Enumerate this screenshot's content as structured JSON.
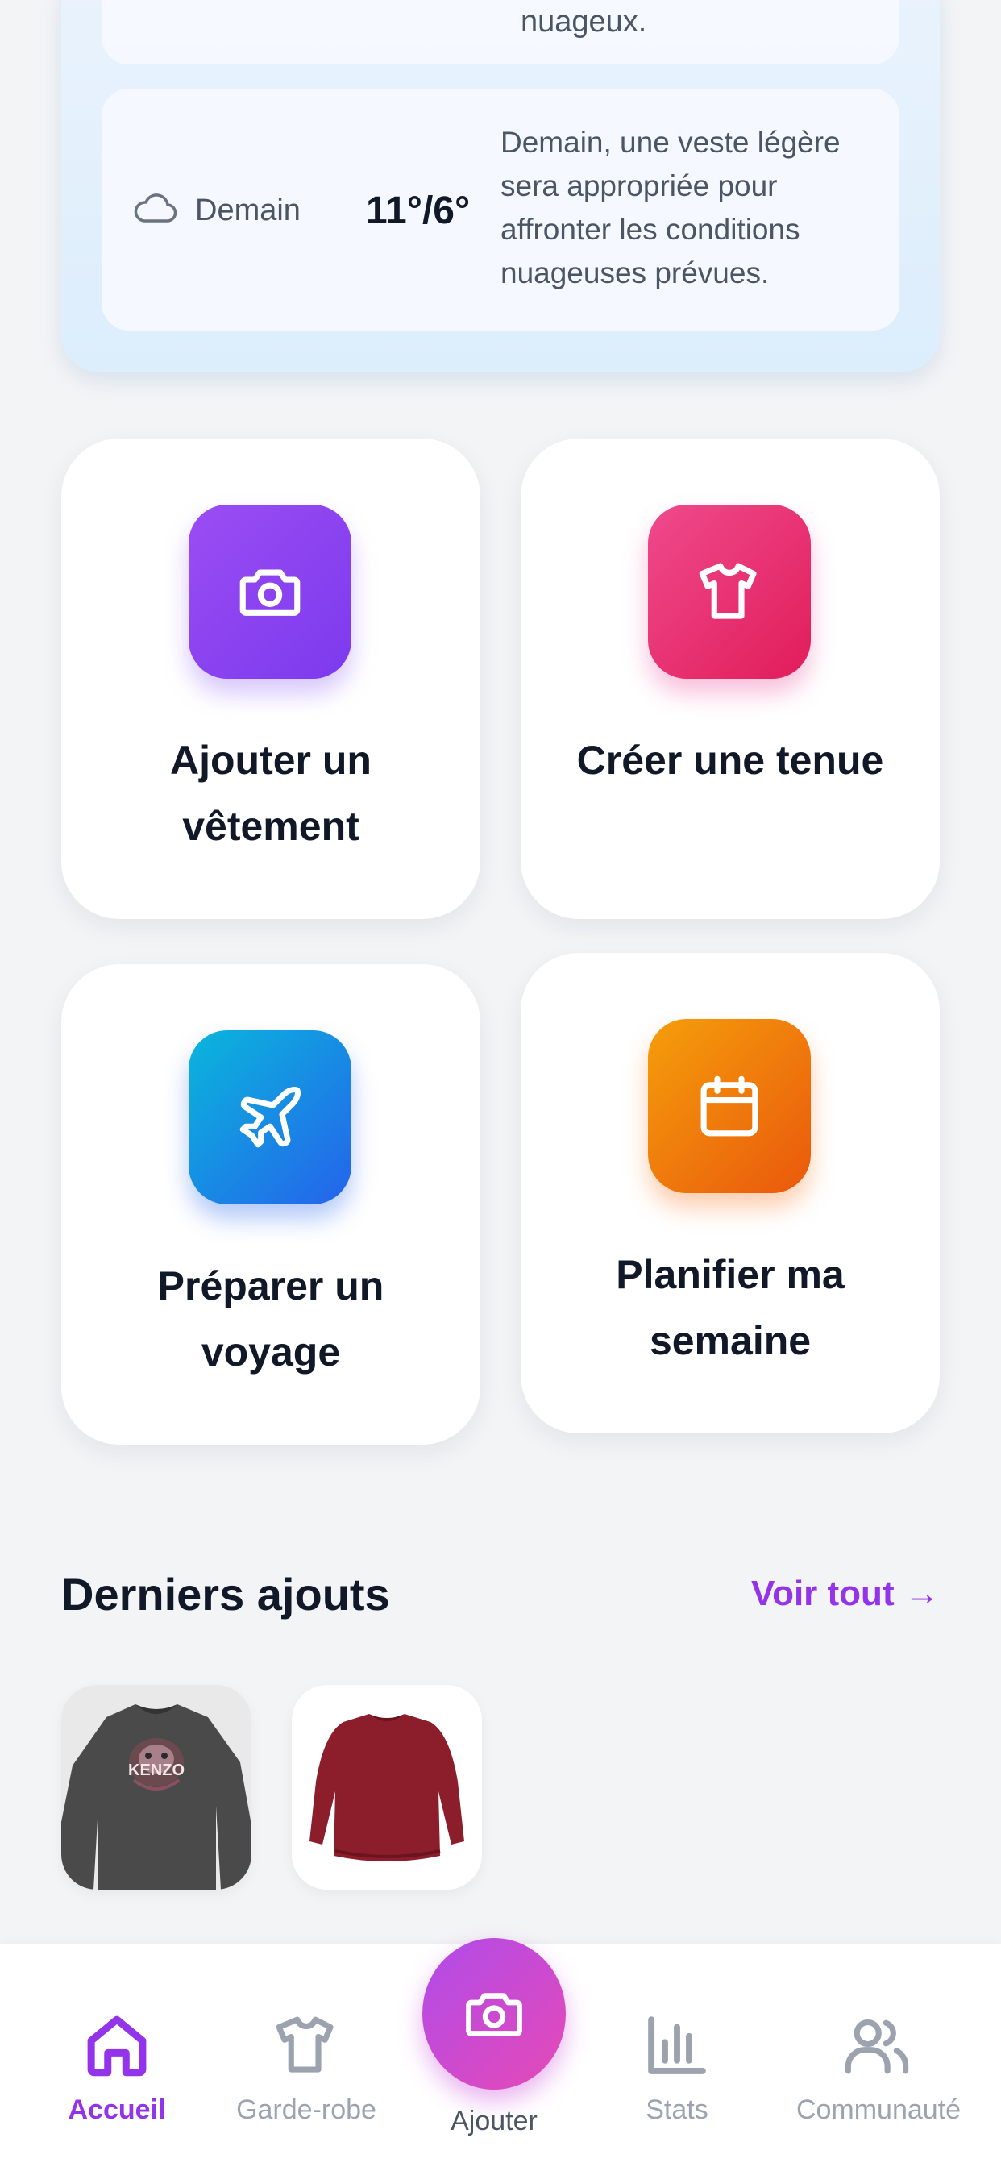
{
  "weather": {
    "top_text": "nuageux.",
    "tomorrow": {
      "icon": "cloud-icon",
      "day": "Demain",
      "temp": "11°/6°",
      "description": "Demain, une veste légère sera appropriée pour affronter les conditions nuageuses prévues."
    }
  },
  "actions": [
    {
      "label": "Ajouter un vêtement",
      "icon": "camera-icon",
      "color": "#8b5cf6"
    },
    {
      "label": "Créer une tenue",
      "icon": "tshirt-icon",
      "color": "#ec4899"
    },
    {
      "label": "Préparer un voyage",
      "icon": "plane-icon",
      "color": "#2563eb"
    },
    {
      "label": "Planifier ma semaine",
      "icon": "calendar-icon",
      "color": "#f97316"
    }
  ],
  "recent": {
    "title": "Derniers ajouts",
    "see_all": "Voir tout →",
    "items": [
      {
        "name": "grey-sweatshirt-tiger",
        "logo_text": "KENZO"
      },
      {
        "name": "burgundy-sweater"
      }
    ]
  },
  "nav": {
    "active": "Accueil",
    "items": [
      {
        "label": "Accueil",
        "icon": "home-icon"
      },
      {
        "label": "Garde-robe",
        "icon": "tshirt-icon"
      },
      {
        "label": "Ajouter",
        "icon": "camera-icon"
      },
      {
        "label": "Stats",
        "icon": "bar-chart-icon"
      },
      {
        "label": "Communauté",
        "icon": "users-icon"
      }
    ]
  },
  "colors": {
    "accent": "#9333ea",
    "background": "#f3f4f6",
    "weather_card": "#e3f0fc"
  }
}
